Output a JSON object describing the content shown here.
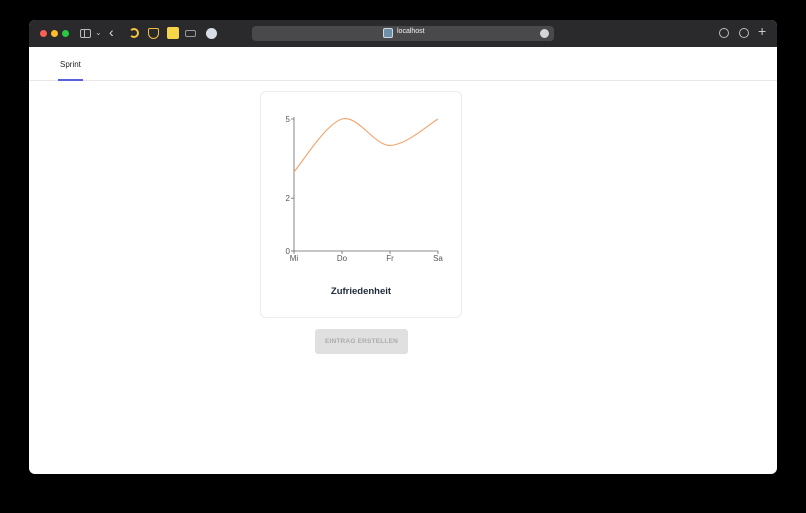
{
  "browser": {
    "url": "localhost"
  },
  "nav": {
    "tabs": [
      {
        "label": "Sprint",
        "active": true
      }
    ],
    "accent_color": "#5a5fe0"
  },
  "chart_data": {
    "type": "line",
    "title": "Zufriedenheit",
    "categories": [
      "Mi",
      "Do",
      "Fr",
      "Sa"
    ],
    "x": [
      "Mi",
      "Do",
      "Fr",
      "Sa"
    ],
    "series": [
      {
        "values": [
          3,
          5,
          4,
          5
        ],
        "color": "#f2a36b",
        "curve": "smooth"
      }
    ],
    "ylim": [
      0,
      5
    ],
    "yticks": [
      0,
      2,
      5
    ],
    "grid": false,
    "xlabel": "",
    "ylabel": ""
  },
  "actions": {
    "create_entry_label": "EINTRAG ERSTELLEN",
    "create_entry_disabled": true
  }
}
